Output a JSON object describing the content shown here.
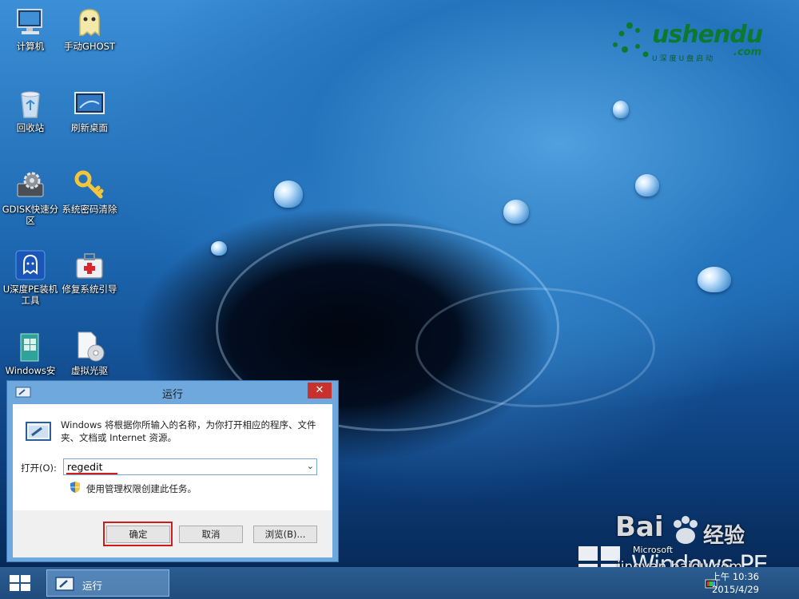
{
  "logo": {
    "main": "ushendu",
    "dotcom": ".com",
    "subtitle": "U深度U盘启动"
  },
  "desktop_icons": [
    {
      "label": "计算机",
      "icon": "computer-icon"
    },
    {
      "label": "手动GHOST",
      "icon": "ghost-icon"
    },
    {
      "label": "回收站",
      "icon": "recycle-bin-icon"
    },
    {
      "label": "刷新桌面",
      "icon": "refresh-desktop-icon"
    },
    {
      "label": "GDISK快速分区",
      "icon": "disk-gear-icon"
    },
    {
      "label": "系统密码清除",
      "icon": "key-icon"
    },
    {
      "label": "U深度PE装机工具",
      "icon": "pe-install-tool-icon"
    },
    {
      "label": "修复系统引导",
      "icon": "repair-kit-icon"
    },
    {
      "label": "Windows安",
      "icon": "windows-install-icon"
    },
    {
      "label": "虚拟光驱",
      "icon": "virtual-drive-icon"
    }
  ],
  "run_dialog": {
    "title": "运行",
    "close_label": "✕",
    "description": "Windows 将根据你所输入的名称，为你打开相应的程序、文件夹、文档或 Internet 资源。",
    "open_label": "打开(O):",
    "open_value": "regedit",
    "admin_note": "使用管理权限创建此任务。",
    "ok_label": "确定",
    "cancel_label": "取消",
    "browse_label": "浏览(B)..."
  },
  "taskbar": {
    "run_task_label": "运行",
    "time": "上午 10:36",
    "date": "2015/4/29"
  },
  "watermark": {
    "microsoft": "Microsoft",
    "windows_pe": "Windows PE",
    "baidu": "Bai",
    "baidu_cn": "经验",
    "jingyan": "jingyan.baidu.com"
  }
}
